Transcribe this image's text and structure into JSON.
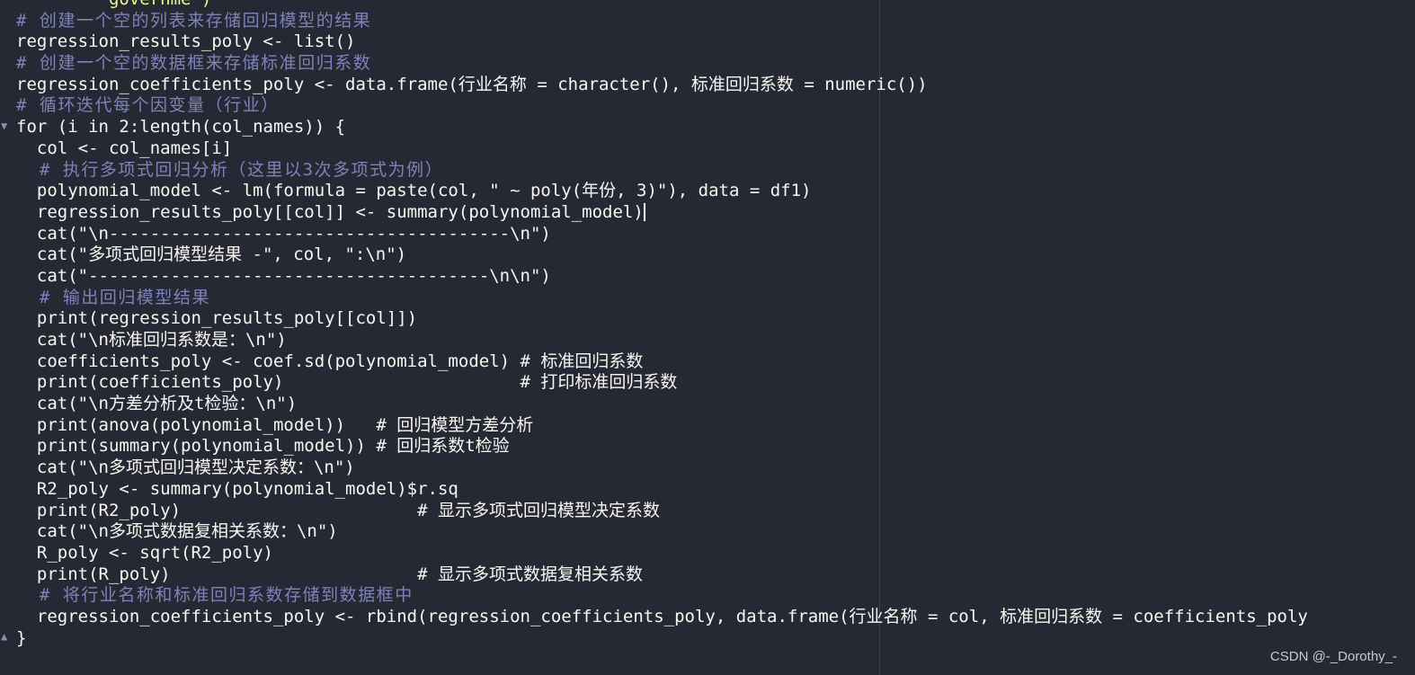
{
  "code": {
    "lines": [
      "         governme\")",
      "# 创建一个空的列表来存储回归模型的结果",
      "regression_results_poly <- list()",
      "# 创建一个空的数据框来存储标准回归系数",
      "regression_coefficients_poly <- data.frame(行业名称 = character(), 标准回归系数 = numeric())",
      "# 循环迭代每个因变量（行业）",
      "for (i in 2:length(col_names)) {",
      "  col <- col_names[i]",
      "  # 执行多项式回归分析（这里以3次多项式为例）",
      "  polynomial_model <- lm(formula = paste(col, \" ~ poly(年份, 3)\"), data = df1)",
      "  regression_results_poly[[col]] <- summary(polynomial_model)",
      "  cat(\"\\n---------------------------------------\\n\")",
      "  cat(\"多项式回归模型结果 -\", col, \":\\n\")",
      "  cat(\"---------------------------------------\\n\\n\")",
      "  # 输出回归模型结果",
      "  print(regression_results_poly[[col]])",
      "  cat(\"\\n标准回归系数是：\\n\")",
      "  coefficients_poly <- coef.sd(polynomial_model) # 标准回归系数",
      "  print(coefficients_poly)                       # 打印标准回归系数",
      "  cat(\"\\n方差分析及t检验：\\n\")",
      "  print(anova(polynomial_model))   # 回归模型方差分析",
      "  print(summary(polynomial_model)) # 回归系数t检验",
      "  cat(\"\\n多项式回归模型决定系数：\\n\")",
      "  R2_poly <- summary(polynomial_model)$r.sq",
      "  print(R2_poly)                       # 显示多项式回归模型决定系数",
      "  cat(\"\\n多项式数据复相关系数：\\n\")",
      "  R_poly <- sqrt(R2_poly)",
      "  print(R_poly)                        # 显示多项式数据复相关系数",
      "  # 将行业名称和标准回归系数存储到数据框中",
      "  regression_coefficients_poly <- rbind(regression_coefficients_poly, data.frame(行业名称 = col, 标准回归系数 = coefficients_poly",
      "}"
    ]
  },
  "watermark": "CSDN @-_Dorothy_-"
}
